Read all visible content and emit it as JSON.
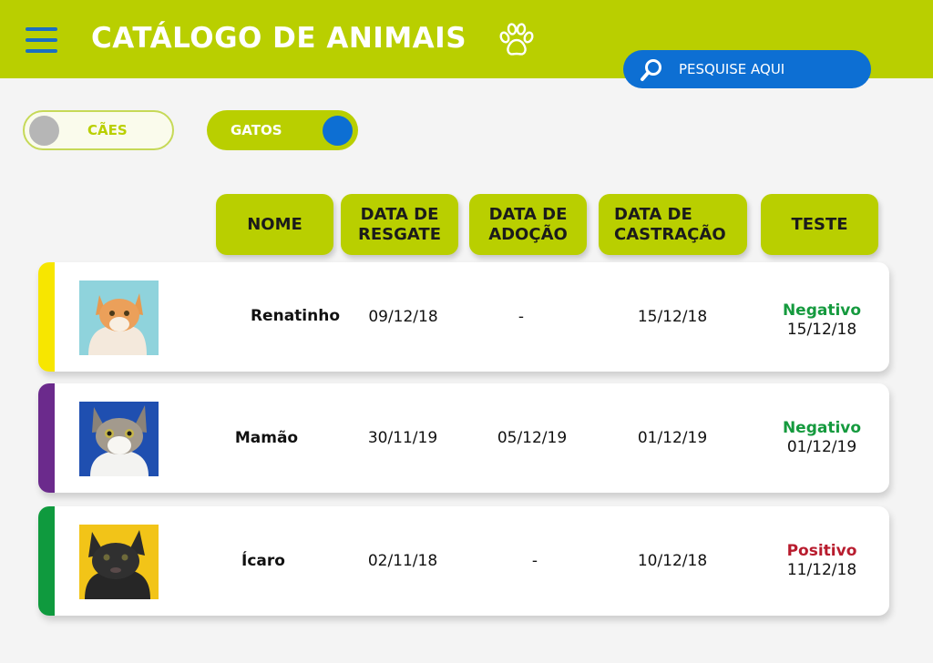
{
  "header": {
    "title": "CATÁLOGO DE ANIMAIS",
    "search_placeholder": "PESQUISE AQUI"
  },
  "toggles": {
    "dogs": {
      "label": "CÃES",
      "on": false
    },
    "cats": {
      "label": "GATOS",
      "on": true
    }
  },
  "columns": {
    "name": "NOME",
    "rescue": [
      "DATA DE",
      "RESGATE"
    ],
    "adoption": [
      "DATA DE",
      "ADOÇÃO"
    ],
    "castration": [
      "DATA DE",
      "CASTRAÇÃO"
    ],
    "test": "TESTE"
  },
  "rows": [
    {
      "name": "Renatinho",
      "rescue": "09/12/18",
      "adoption": "-",
      "castration": "15/12/18",
      "test_result": "Negativo",
      "test_date": "15/12/18",
      "strip_color": "#f7e600",
      "result_color": "#159a3e"
    },
    {
      "name": "Mamão",
      "rescue": "30/11/19",
      "adoption": "05/12/19",
      "castration": "01/12/19",
      "test_result": "Negativo",
      "test_date": "01/12/19",
      "strip_color": "#6b2a8c",
      "result_color": "#159a3e"
    },
    {
      "name": "Ícaro",
      "rescue": "02/11/18",
      "adoption": "-",
      "castration": "10/12/18",
      "test_result": "Positivo",
      "test_date": "11/12/18",
      "strip_color": "#0f9a3e",
      "result_color": "#b81c2e"
    }
  ],
  "colors": {
    "accent": "#b9cf00",
    "primary": "#0d6fd3"
  }
}
